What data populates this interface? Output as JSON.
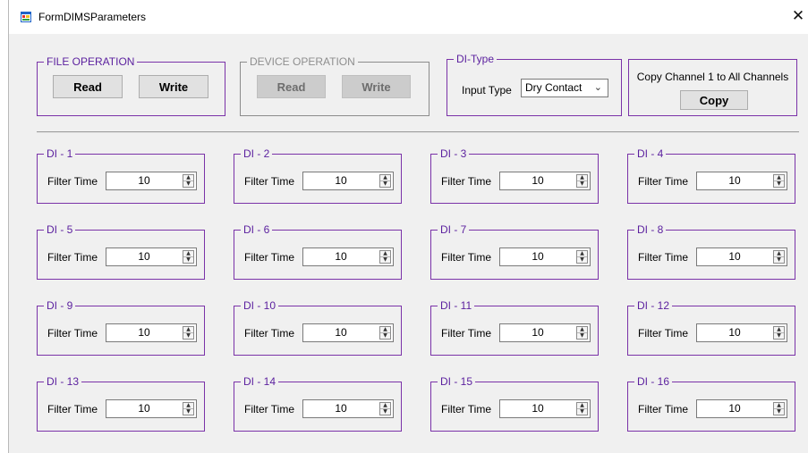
{
  "window": {
    "title": "FormDIMSParameters",
    "close_glyph": "✕"
  },
  "file_operation": {
    "title": "FILE OPERATION",
    "read_label": "Read",
    "write_label": "Write"
  },
  "device_operation": {
    "title": "DEVICE OPERATION",
    "read_label": "Read",
    "write_label": "Write"
  },
  "di_type": {
    "title": "DI-Type",
    "input_type_label": "Input Type",
    "input_type_value": "Dry Contact"
  },
  "copy_panel": {
    "caption": "Copy Channel 1 to All Channels",
    "copy_label": "Copy"
  },
  "channels": [
    {
      "title": "DI - 1",
      "label": "Filter Time",
      "value": "10"
    },
    {
      "title": "DI - 2",
      "label": "Filter Time",
      "value": "10"
    },
    {
      "title": "DI - 3",
      "label": "Filter Time",
      "value": "10"
    },
    {
      "title": "DI - 4",
      "label": "Filter Time",
      "value": "10"
    },
    {
      "title": "DI - 5",
      "label": "Filter Time",
      "value": "10"
    },
    {
      "title": "DI - 6",
      "label": "Filter Time",
      "value": "10"
    },
    {
      "title": "DI  - 7",
      "label": "Filter Time",
      "value": "10"
    },
    {
      "title": "DI - 8",
      "label": "Filter Time",
      "value": "10"
    },
    {
      "title": "DI - 9",
      "label": "Filter Time",
      "value": "10"
    },
    {
      "title": "DI - 10",
      "label": "Filter Time",
      "value": "10"
    },
    {
      "title": "DI - 11",
      "label": "Filter Time",
      "value": "10"
    },
    {
      "title": "DI - 12",
      "label": "Filter Time",
      "value": "10"
    },
    {
      "title": "DI - 13",
      "label": "Filter Time",
      "value": "10"
    },
    {
      "title": "DI - 14",
      "label": "Filter Time",
      "value": "10"
    },
    {
      "title": "DI - 15",
      "label": "Filter Time",
      "value": "10"
    },
    {
      "title": "DI - 16",
      "label": "Filter Time",
      "value": "10"
    }
  ],
  "colors": {
    "group_border": "#7a32a8",
    "group_title": "#5a1f9e",
    "window_bg": "#f0f0f0"
  },
  "icons": {
    "app": "form-app-icon",
    "close": "close-icon",
    "spinner_up": "spin-up-icon",
    "spinner_down": "spin-down-icon",
    "dropdown": "chevron-down-icon"
  }
}
